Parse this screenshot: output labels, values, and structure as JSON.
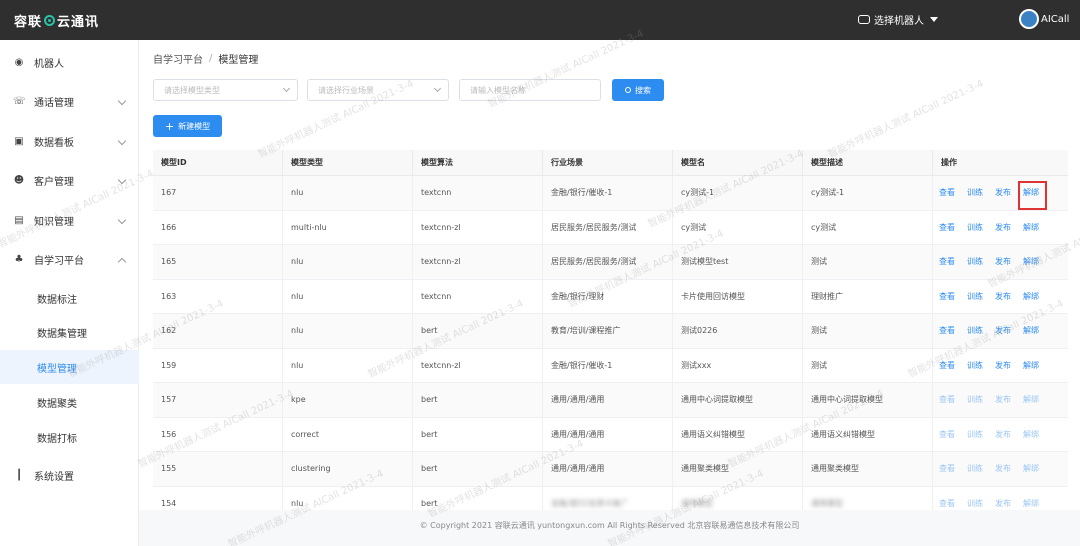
{
  "app": {
    "logo_left": "容联",
    "logo_right": "云通讯",
    "robot_select": "选择机器人",
    "user": "AICall"
  },
  "sidebar": {
    "items": [
      {
        "label": "机器人",
        "icon": "robot-icon"
      },
      {
        "label": "通话管理",
        "icon": "phone-icon"
      },
      {
        "label": "数据看板",
        "icon": "chart-icon"
      },
      {
        "label": "客户管理",
        "icon": "users-icon"
      },
      {
        "label": "知识管理",
        "icon": "book-icon"
      },
      {
        "label": "自学习平台",
        "icon": "learning-icon"
      },
      {
        "label": "系统设置",
        "icon": "settings-icon"
      }
    ],
    "sub_items": [
      "数据标注",
      "数据集管理",
      "模型管理",
      "数据聚类",
      "数据打标"
    ]
  },
  "breadcrumb": {
    "parent": "自学习平台",
    "separator": "/",
    "current": "模型管理"
  },
  "filters": {
    "model_type_placeholder": "请选择模型类型",
    "industry_placeholder": "请选择行业场景",
    "model_name_placeholder": "请输入模型名称",
    "search_label": "搜索",
    "new_model_label": "新建模型"
  },
  "table": {
    "headers": [
      "模型ID",
      "模型类型",
      "模型算法",
      "行业场景",
      "模型名",
      "模型描述",
      "操作"
    ],
    "actions": [
      "查看",
      "训练",
      "发布",
      "解绑"
    ],
    "rows": [
      {
        "id": "167",
        "type": "nlu",
        "algo": "textcnn",
        "scene": "金融/银行/催收-1",
        "name": "cy测试-1",
        "desc": "cy测试-1"
      },
      {
        "id": "166",
        "type": "multi-nlu",
        "algo": "textcnn-zl",
        "scene": "居民服务/居民服务/测试",
        "name": "cy测试",
        "desc": "cy测试"
      },
      {
        "id": "165",
        "type": "nlu",
        "algo": "textcnn-zl",
        "scene": "居民服务/居民服务/测试",
        "name": "测试模型test",
        "desc": "测试"
      },
      {
        "id": "163",
        "type": "nlu",
        "algo": "textcnn",
        "scene": "金融/银行/理财",
        "name": "卡片使用回访模型",
        "desc": "理财推广"
      },
      {
        "id": "162",
        "type": "nlu",
        "algo": "bert",
        "scene": "教育/培训/课程推广",
        "name": "测试0226",
        "desc": "测试"
      },
      {
        "id": "159",
        "type": "nlu",
        "algo": "textcnn-zl",
        "scene": "金融/银行/催收-1",
        "name": "测试xxx",
        "desc": "测试"
      },
      {
        "id": "157",
        "type": "kpe",
        "algo": "bert",
        "scene": "通用/通用/通用",
        "name": "通用中心词提取模型",
        "desc": "通用中心词提取模型"
      },
      {
        "id": "156",
        "type": "correct",
        "algo": "bert",
        "scene": "通用/通用/通用",
        "name": "通用语义纠错模型",
        "desc": "通用语义纠错模型"
      },
      {
        "id": "155",
        "type": "clustering",
        "algo": "bert",
        "scene": "通用/通用/通用",
        "name": "通用聚类模型",
        "desc": "通用聚类模型"
      },
      {
        "id": "154",
        "type": "nlu",
        "algo": "bert",
        "scene": "金融/银行/信用卡推广",
        "name": "通用模型",
        "desc": "通用模型"
      }
    ]
  },
  "footer": {
    "text": "© Copyright 2021  容联云通讯  yuntongxun.com  All Rights Reserved  北京容联易通信息技术有限公司"
  },
  "watermark": "智能外呼机器人测试  AICall  2021-3-4",
  "colors": {
    "accent": "#2d8cf0",
    "topbar": "#2f2f2f",
    "highlight_box": "#dd3333"
  }
}
